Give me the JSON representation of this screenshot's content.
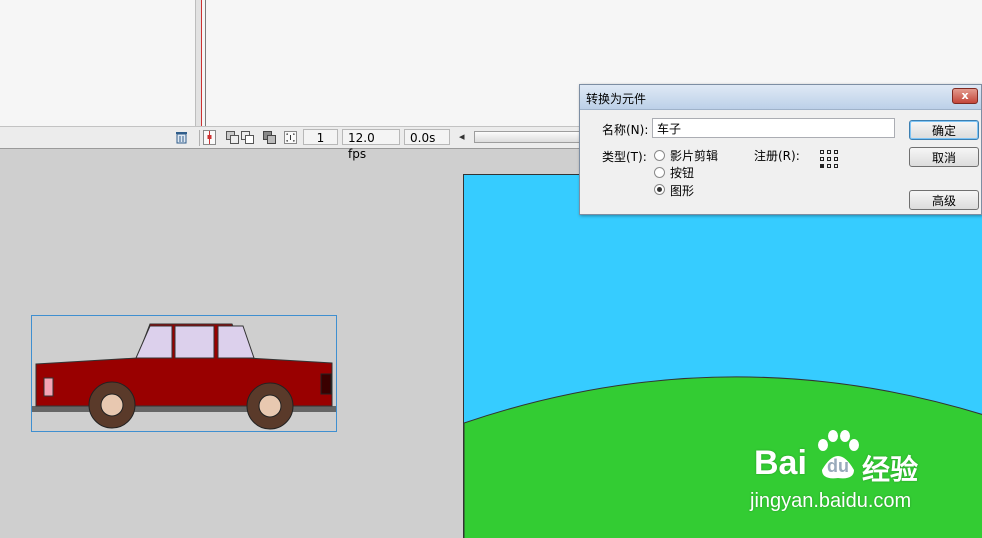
{
  "timeline": {
    "frame": "1",
    "fps": "12.0 fps",
    "time": "0.0s",
    "icons": [
      "trash-icon",
      "center-frame-icon",
      "onion-skin-icon",
      "onion-outline-icon",
      "edit-multiple-icon",
      "onion-markers-icon"
    ]
  },
  "dialog": {
    "title": "转换为元件",
    "close_label": "x",
    "name_label": "名称(N):",
    "name_value": "车子",
    "type_label": "类型(T):",
    "types": [
      {
        "label": "影片剪辑",
        "selected": false
      },
      {
        "label": "按钮",
        "selected": false
      },
      {
        "label": "图形",
        "selected": true
      }
    ],
    "registration_label": "注册(R):",
    "ok_label": "确定",
    "cancel_label": "取消",
    "advanced_label": "高级"
  },
  "colors": {
    "stage_sky": "#36ccff",
    "stage_ground": "#33cc33",
    "car_body": "#990000",
    "car_window": "#dcd0ec",
    "wheel": "#5a3a2a",
    "hub": "#e8c8b0"
  },
  "watermark": {
    "brand": "Bai",
    "brand_tail": "du",
    "suffix": "经验",
    "url": "jingyan.baidu.com"
  }
}
